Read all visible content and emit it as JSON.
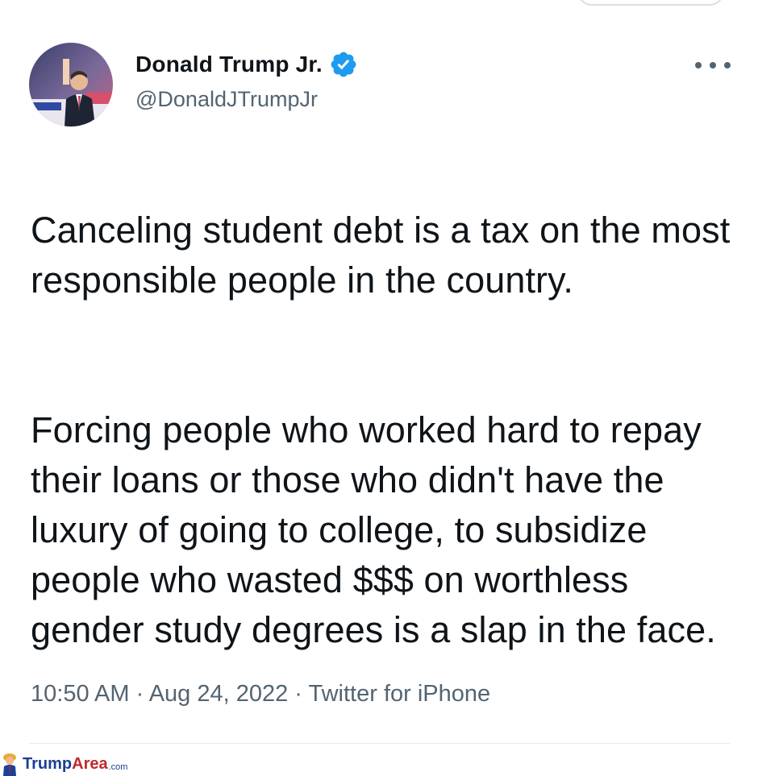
{
  "tweet": {
    "author": {
      "display_name": "Donald Trump Jr.",
      "handle": "@DonaldJTrumpJr",
      "verified": true,
      "avatar_icon": "profile-photo"
    },
    "text": {
      "paragraph_1": "Canceling student debt is a tax on the most responsible people in the country.",
      "paragraph_2": "Forcing people who worked hard to repay their loans or those who didn't have the luxury of going to college, to subsidize people who wasted $$$ on worthless gender study degrees is a slap in the face."
    },
    "meta": {
      "time": "10:50 AM",
      "separator_1": " · ",
      "date": "Aug 24, 2022",
      "separator_2": " · ",
      "source": "Twitter for iPhone"
    },
    "more_icon": "ellipsis-icon"
  },
  "watermark": {
    "brand_main": "Trump",
    "brand_accent": "Area",
    "brand_suffix": ".com"
  },
  "colors": {
    "text_primary": "#0f1419",
    "text_secondary": "#536471",
    "verified_blue": "#1d9bf0",
    "divider": "#e6eaed",
    "watermark_blue": "#1d3f94",
    "watermark_red": "#c0282d"
  }
}
